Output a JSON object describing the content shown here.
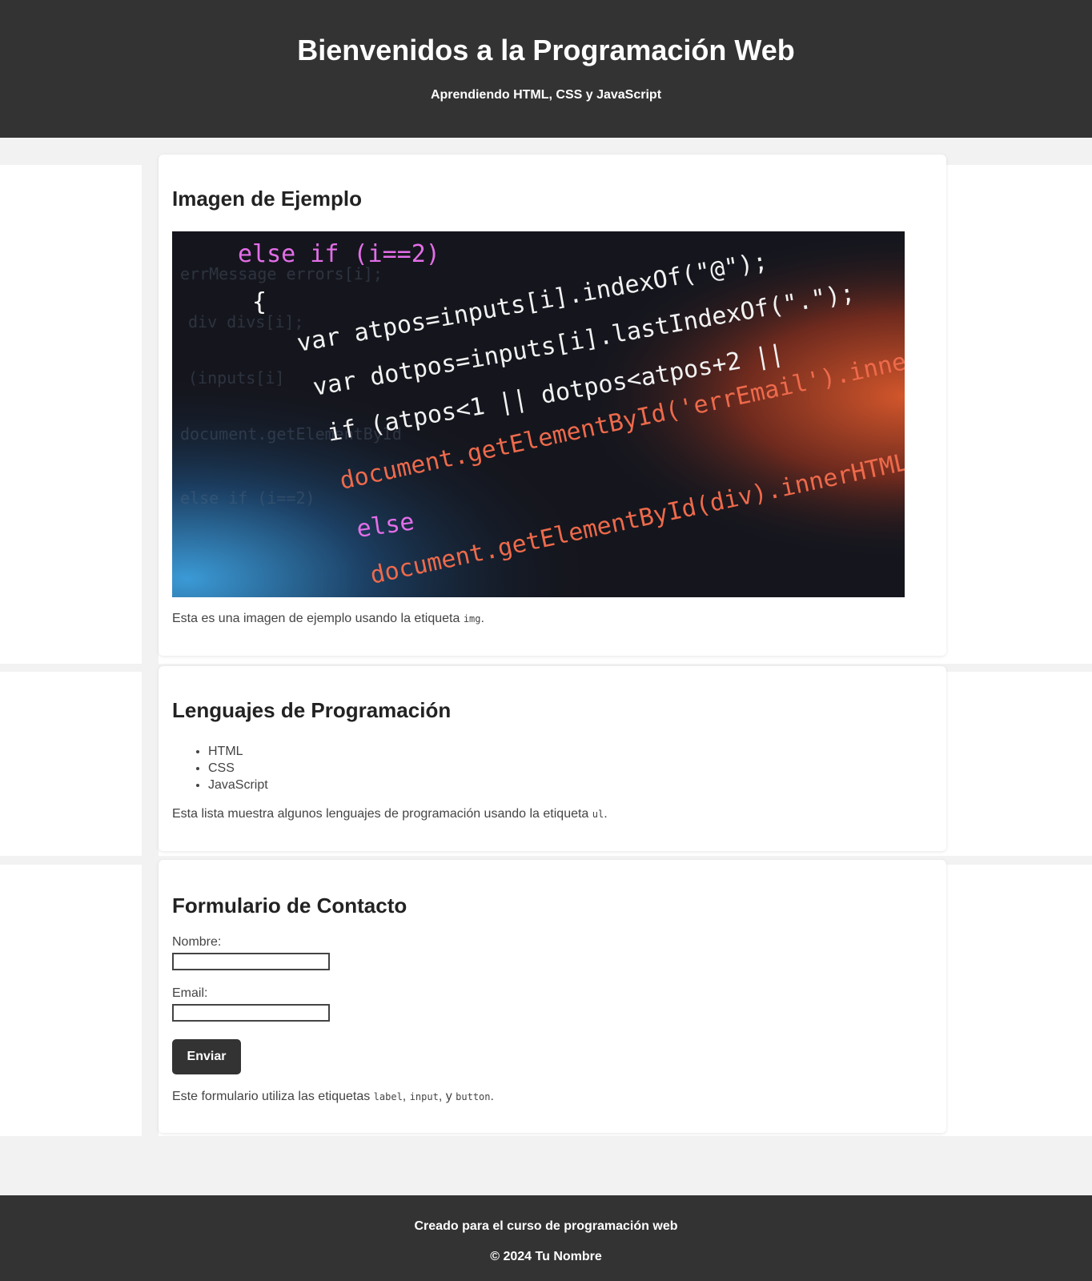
{
  "header": {
    "title": "Bienvenidos a la Programación Web",
    "subtitle": "Aprendiendo HTML, CSS y JavaScript"
  },
  "image_section": {
    "heading": "Imagen de Ejemplo",
    "desc_pre": "Esta es una imagen de ejemplo usando la etiqueta ",
    "desc_code": "img",
    "desc_post": ".",
    "code_lines": [
      "else if (i==2)",
      "{",
      "var atpos=inputs[i].indexOf(\"@\");",
      "var dotpos=inputs[i].lastIndexOf(\".\");",
      "if (atpos<1 || dotpos<atpos+2 ||",
      "document.getElementById('errEmail').innerHTML",
      "else",
      "document.getElementById(div).innerHTML"
    ]
  },
  "languages_section": {
    "heading": "Lenguajes de Programación",
    "items": [
      "HTML",
      "CSS",
      "JavaScript"
    ],
    "desc_pre": "Esta lista muestra algunos lenguajes de programación usando la etiqueta ",
    "desc_code": "ul",
    "desc_post": "."
  },
  "contact_section": {
    "heading": "Formulario de Contacto",
    "name_label": "Nombre:",
    "name_value": "",
    "email_label": "Email:",
    "email_value": "",
    "submit_label": "Enviar",
    "desc_pre": "Este formulario utiliza las etiquetas ",
    "desc_code1": "label",
    "desc_sep1": ", ",
    "desc_code2": "input",
    "desc_sep2": ", y ",
    "desc_code3": "button",
    "desc_post": "."
  },
  "footer": {
    "line1": "Creado para el curso de programación web",
    "line2": "© 2024 Tu Nombre"
  }
}
